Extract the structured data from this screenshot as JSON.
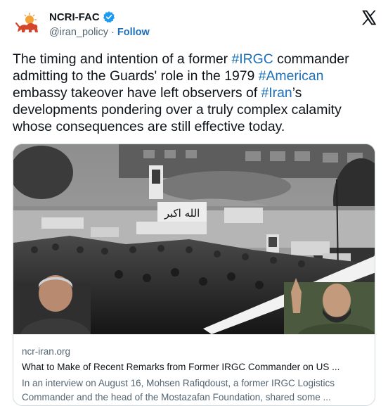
{
  "account": {
    "display_name": "NCRI-FAC",
    "handle": "@iran_policy",
    "separator": "·",
    "follow_label": "Follow",
    "avatar_icon": "lion-and-sun-logo-icon",
    "verified_icon": "verified-badge-icon",
    "platform_icon": "x-logo-icon"
  },
  "tweet": {
    "segments": [
      {
        "text": "The timing and intention of a former ",
        "tag": false
      },
      {
        "text": "#IRGC",
        "tag": true
      },
      {
        "text": " commander admitting to the Guards' role in the 1979 ",
        "tag": false
      },
      {
        "text": "#American",
        "tag": true
      },
      {
        "text": " embassy takeover have left observers of ",
        "tag": false
      },
      {
        "text": "#Iran",
        "tag": true
      },
      {
        "text": "’s developments pondering over a truly complex calamity whose consequences are still effective today.",
        "tag": false
      }
    ]
  },
  "card": {
    "image_description": "black-and-white photo of a crowd outside the US embassy in Tehran",
    "domain": "ncr-iran.org",
    "title": "What to Make of Recent Remarks from Former IRGC Commander on US ...",
    "description": "In an interview on August 16, Mohsen Rafiqdoust, a former IRGC Logistics Commander and the head of the Mostazafan Foundation, shared some ..."
  },
  "colors": {
    "link": "#1d6fb8",
    "secondary_text": "#536471",
    "verified": "#1d9bf0",
    "logo_red": "#d4452b",
    "logo_orange": "#f2a23a"
  }
}
